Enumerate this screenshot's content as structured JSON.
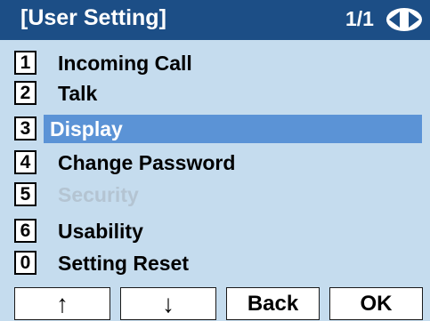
{
  "header": {
    "title": "[User Setting]",
    "page": "1/1",
    "nav_icon": "left-right-arrow-icon"
  },
  "menu": {
    "items": [
      {
        "key": "1",
        "label": "Incoming Call",
        "state": "normal"
      },
      {
        "key": "2",
        "label": "Talk",
        "state": "normal"
      },
      {
        "key": "3",
        "label": "Display",
        "state": "selected"
      },
      {
        "key": "4",
        "label": "Change Password",
        "state": "normal"
      },
      {
        "key": "5",
        "label": "Security",
        "state": "disabled"
      },
      {
        "key": "6",
        "label": "Usability",
        "state": "normal"
      },
      {
        "key": "0",
        "label": "Setting Reset",
        "state": "normal"
      }
    ]
  },
  "softkeys": {
    "up": "↑",
    "down": "↓",
    "back": "Back",
    "ok": "OK"
  },
  "colors": {
    "background": "#c5dcee",
    "header": "#1c4e86",
    "selected": "#5b93d6",
    "disabled_text": "#b4c4d2"
  }
}
